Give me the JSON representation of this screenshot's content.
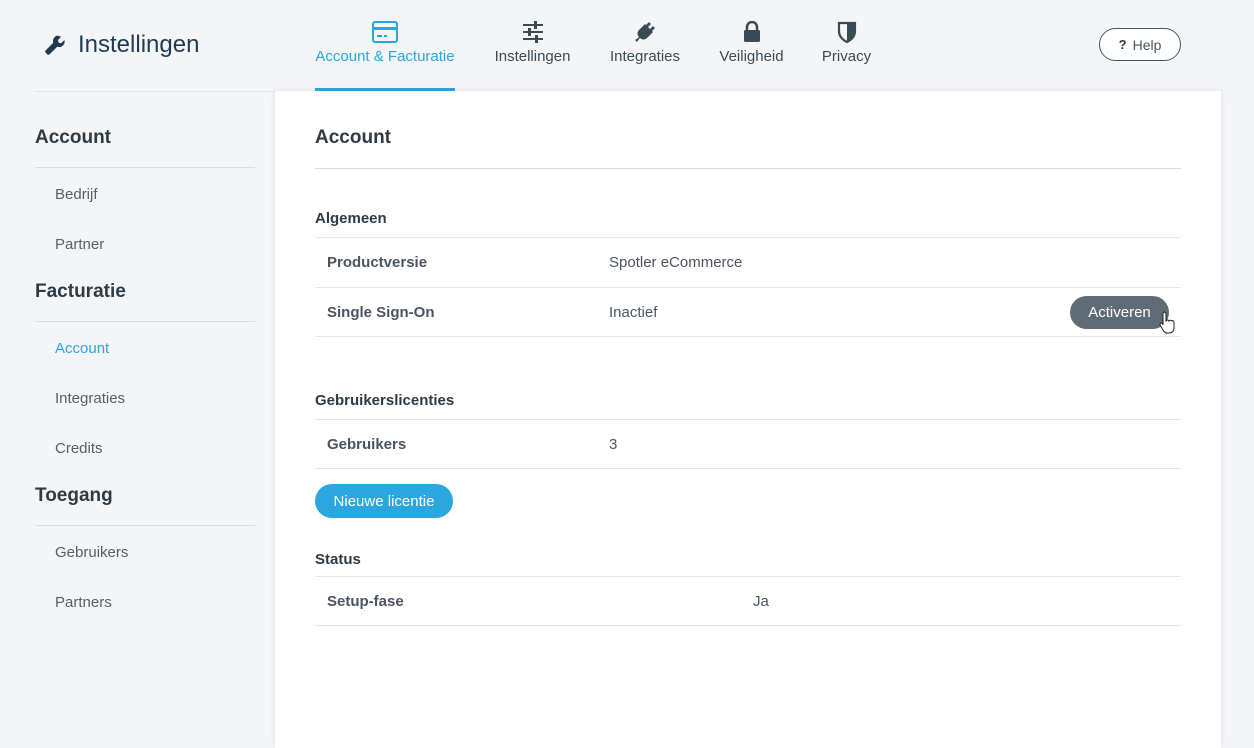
{
  "header": {
    "title": "Instellingen",
    "help_label": "Help",
    "tabs": [
      {
        "label": "Account & Facturatie",
        "icon": "credit-card-icon",
        "active": true
      },
      {
        "label": "Instellingen",
        "icon": "sliders-icon",
        "active": false
      },
      {
        "label": "Integraties",
        "icon": "plug-icon",
        "active": false
      },
      {
        "label": "Veiligheid",
        "icon": "lock-icon",
        "active": false
      },
      {
        "label": "Privacy",
        "icon": "shield-icon",
        "active": false
      }
    ]
  },
  "sidebar": {
    "sections": [
      {
        "title": "Account",
        "items": [
          "Bedrijf",
          "Partner"
        ]
      },
      {
        "title": "Facturatie",
        "items": [
          "Account",
          "Integraties",
          "Credits"
        ]
      },
      {
        "title": "Toegang",
        "items": [
          "Gebruikers",
          "Partners"
        ]
      }
    ],
    "active_item": "Account"
  },
  "main": {
    "title": "Account",
    "algemeen": {
      "title": "Algemeen",
      "rows": [
        {
          "label": "Productversie",
          "value": "Spotler eCommerce"
        },
        {
          "label": "Single Sign-On",
          "value": "Inactief",
          "action": "Activeren"
        }
      ]
    },
    "licenties": {
      "title": "Gebruikerslicenties",
      "rows": [
        {
          "label": "Gebruikers",
          "value": "3"
        }
      ],
      "button": "Nieuwe licentie"
    },
    "status": {
      "title": "Status",
      "rows": [
        {
          "label": "Setup-fase",
          "value": "Ja"
        }
      ]
    }
  },
  "colors": {
    "accent": "#2aa7de",
    "dark_button": "#5f6b75",
    "title_text": "#1f3a52"
  }
}
